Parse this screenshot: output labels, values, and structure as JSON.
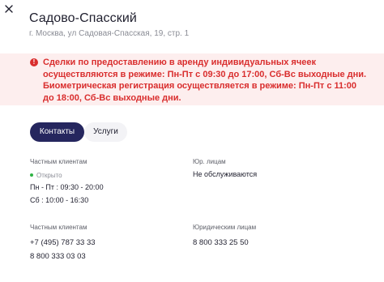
{
  "header": {
    "title": "Садово-Спасский",
    "address": "г. Москва, ул Садовая-Спасская, 19, стр. 1"
  },
  "alert": {
    "icon": "alert-circle-icon",
    "text": "Сделки по предоставлению в аренду индивидуальных ячеек осуществляются в режиме: Пн-Пт с 09:30 до 17:00, Сб-Вс выходные дни. Биометрическая регистрация осуществляется в режиме: Пн-Пт с 11:00 до 18:00, Сб-Вс выходные дни."
  },
  "tabs": [
    {
      "label": "Контакты",
      "active": true
    },
    {
      "label": "Услуги",
      "active": false
    }
  ],
  "hours": {
    "private": {
      "label": "Частным клиентам",
      "status": "Открыто",
      "weekdays": "Пн - Пт : 09:30 - 20:00",
      "weekend": "Сб : 10:00 - 16:30"
    },
    "legal": {
      "label": "Юр. лицам",
      "value": "Не обслуживаются"
    }
  },
  "phones": {
    "private": {
      "label": "Частным клиентам",
      "numbers": [
        "+7 (495) 787 33 33",
        "8 800 333 03 03"
      ]
    },
    "legal": {
      "label": "Юридическим лицам",
      "numbers": [
        "8 800 333 25 50"
      ]
    }
  },
  "colors": {
    "accent": "#25265e",
    "alert_text": "#d92d2d",
    "alert_bg": "#fdeeee",
    "open_status": "#2fb344"
  }
}
